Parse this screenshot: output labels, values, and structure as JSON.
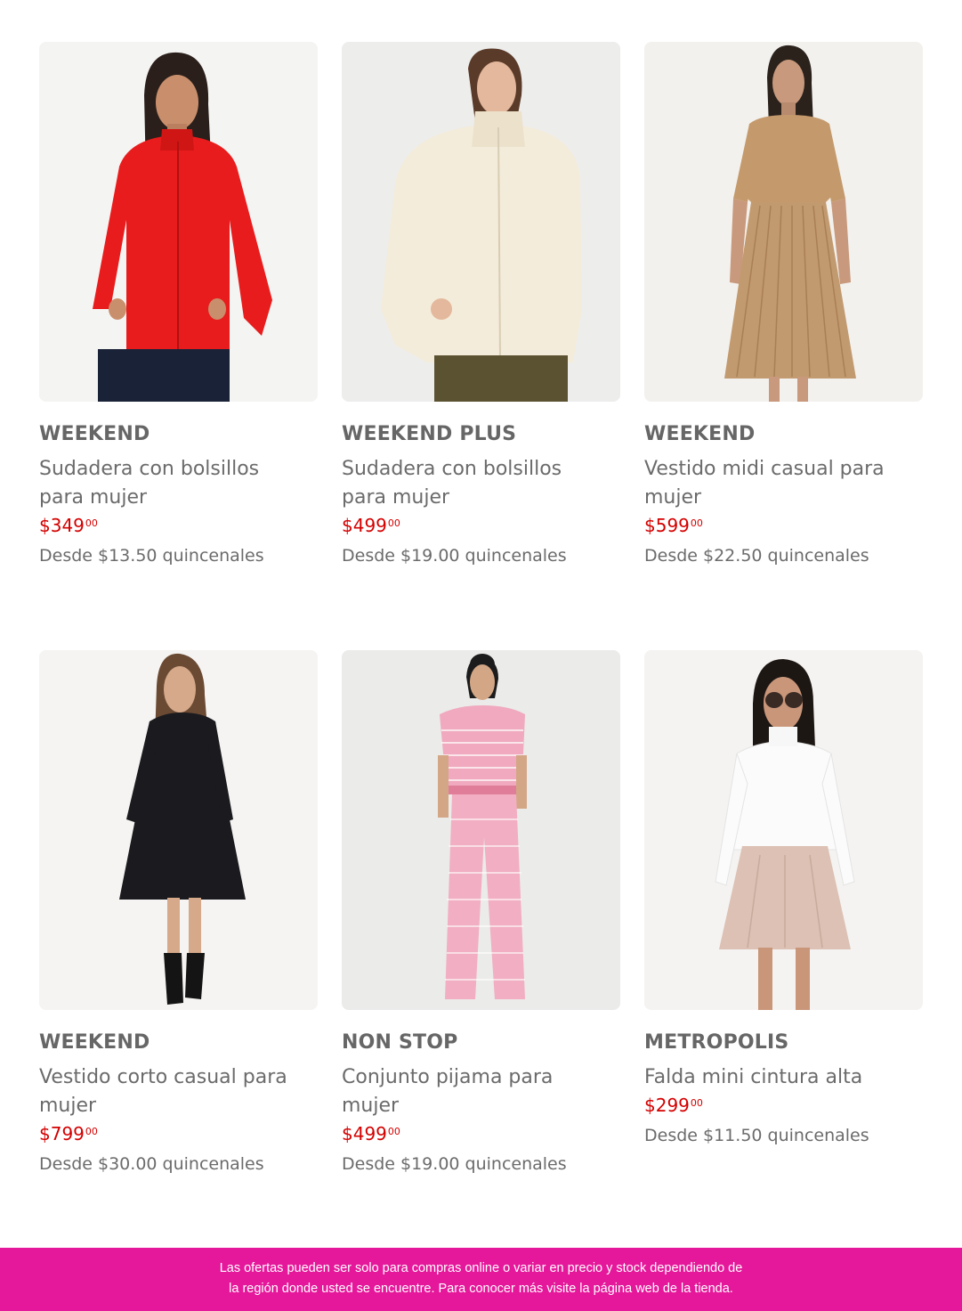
{
  "products": [
    {
      "brand": "WEEKEND",
      "title": "Sudadera con bolsillos para mujer",
      "price": "$349",
      "cents": "00",
      "installments": "Desde $13.50 quincenales",
      "image_icon": "woman-red-fleece-jacket-photo"
    },
    {
      "brand": "WEEKEND PLUS",
      "title": "Sudadera con bolsillos para mujer",
      "price": "$499",
      "cents": "00",
      "installments": "Desde $19.00 quincenales",
      "image_icon": "woman-cream-sherpa-jacket-photo"
    },
    {
      "brand": "WEEKEND",
      "title": "Vestido midi casual para mujer",
      "price": "$599",
      "cents": "00",
      "installments": "Desde $22.50 quincenales",
      "image_icon": "woman-camel-pleated-dress-photo"
    },
    {
      "brand": "WEEKEND",
      "title": "Vestido corto casual para mujer",
      "price": "$799",
      "cents": "00",
      "installments": "Desde $30.00 quincenales",
      "image_icon": "woman-black-short-dress-photo"
    },
    {
      "brand": "NON STOP",
      "title": "Conjunto pijama para mujer",
      "price": "$499",
      "cents": "00",
      "installments": "Desde $19.00 quincenales",
      "image_icon": "woman-pink-pajama-set-photo"
    },
    {
      "brand": "METROPOLIS",
      "title": "Falda mini cintura alta",
      "price": "$299",
      "cents": "00",
      "installments": "Desde $11.50 quincenales",
      "image_icon": "woman-beige-mini-skirt-photo"
    }
  ],
  "footer": {
    "line1": "Las ofertas pueden ser solo para compras online o variar en precio y stock dependiendo de",
    "line2": "la región donde usted se encuentre. Para conocer más visite la página web de la tienda."
  },
  "colors": {
    "price_red": "#d40000",
    "footer_pink": "#e5179a",
    "text_gray": "#6b6b6b"
  }
}
